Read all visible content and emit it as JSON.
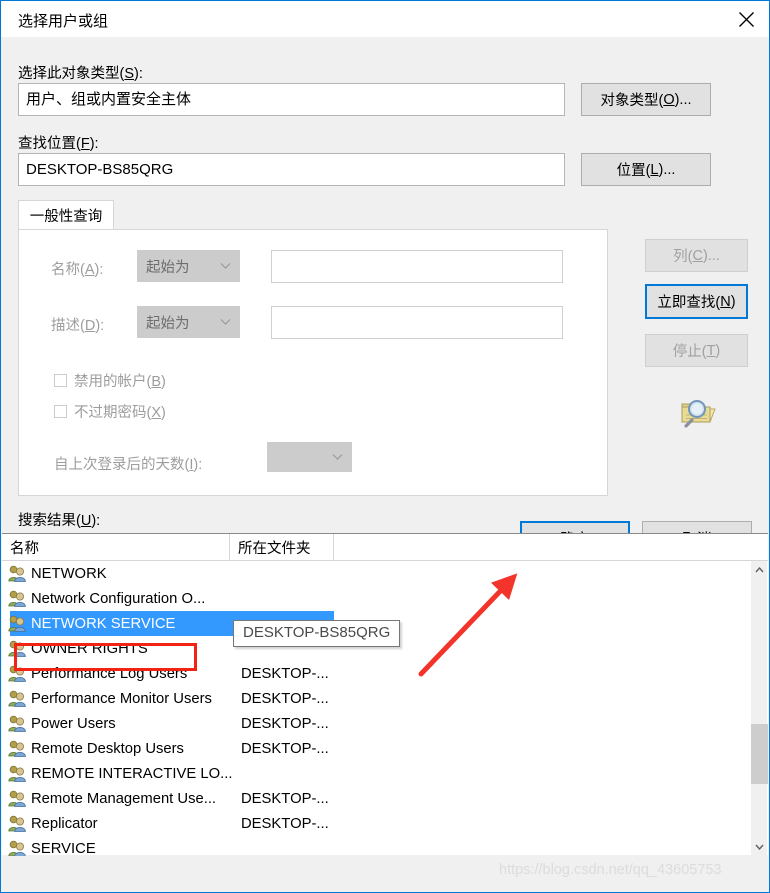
{
  "window": {
    "title": "选择用户或组",
    "close_label": "✕"
  },
  "colors": {
    "accent": "#0078d7",
    "selection": "#3399ff",
    "annotation_red": "#f22314",
    "disabled_text": "#9d9d9d",
    "watermark": "#dcdcdc"
  },
  "object_type": {
    "label": "选择此对象类型(S):",
    "value": "用户、组或内置安全主体",
    "button": "对象类型(O)..."
  },
  "location": {
    "label": "查找位置(F):",
    "value": "DESKTOP-BS85QRG",
    "button": "位置(L)..."
  },
  "query_tab": {
    "tab_label": "一般性查询",
    "name_label": "名称(A):",
    "name_condition": "起始为",
    "name_value": "",
    "desc_label": "描述(D):",
    "desc_condition": "起始为",
    "desc_value": "",
    "disabled_accounts_label": "禁用的帐户(B)",
    "non_expiring_password_label": "不过期密码(X)",
    "days_since_logon_label": "自上次登录后的天数(I):",
    "days_since_logon_value": ""
  },
  "side_buttons": {
    "columns": "列(C)...",
    "find_now": "立即查找(N)",
    "stop": "停止(T)",
    "search_icon_name": "folder-magnifier-icon"
  },
  "dialog_buttons": {
    "ok": "确定",
    "cancel": "取消"
  },
  "results": {
    "label": "搜索结果(U):",
    "columns": [
      "名称",
      "所在文件夹"
    ],
    "tooltip": "DESKTOP-BS85QRG",
    "rows": [
      {
        "name": "NETWORK",
        "folder": "",
        "selected": false
      },
      {
        "name": "Network Configuration O...",
        "folder": "",
        "selected": false
      },
      {
        "name": "NETWORK SERVICE",
        "folder": "",
        "selected": true
      },
      {
        "name": "OWNER RIGHTS",
        "folder": "",
        "selected": false
      },
      {
        "name": "Performance Log Users",
        "folder": "DESKTOP-...",
        "selected": false
      },
      {
        "name": "Performance Monitor Users",
        "folder": "DESKTOP-...",
        "selected": false
      },
      {
        "name": "Power Users",
        "folder": "DESKTOP-...",
        "selected": false
      },
      {
        "name": "Remote Desktop Users",
        "folder": "DESKTOP-...",
        "selected": false
      },
      {
        "name": "REMOTE INTERACTIVE LO...",
        "folder": "",
        "selected": false
      },
      {
        "name": "Remote Management Use...",
        "folder": "DESKTOP-...",
        "selected": false
      },
      {
        "name": "Replicator",
        "folder": "DESKTOP-...",
        "selected": false
      },
      {
        "name": "SERVICE",
        "folder": "",
        "selected": false
      }
    ]
  },
  "watermark": "https://blog.csdn.net/qq_43605753"
}
